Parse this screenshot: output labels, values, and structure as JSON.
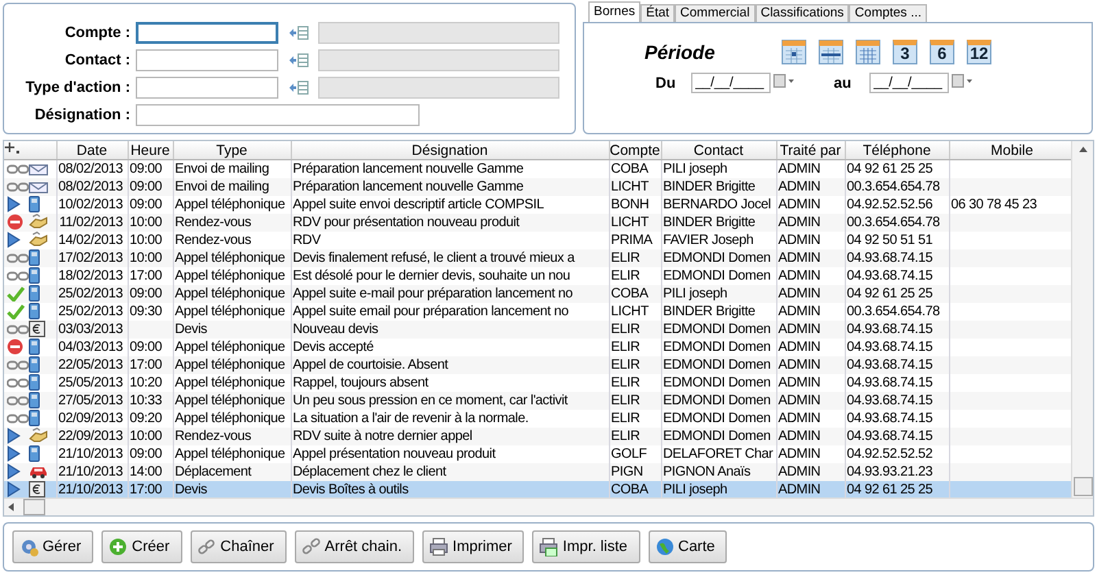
{
  "filter_form": {
    "fields": [
      {
        "label": "Compte :",
        "kind": "lookup",
        "focused": true
      },
      {
        "label": "Contact :",
        "kind": "lookup",
        "focused": false
      },
      {
        "label": "Type d'action :",
        "kind": "lookup",
        "focused": false
      },
      {
        "label": "Désignation :",
        "kind": "text",
        "focused": false
      }
    ]
  },
  "tabs": [
    {
      "label": "Bornes",
      "selected": true
    },
    {
      "label": "État",
      "selected": false
    },
    {
      "label": "Commercial",
      "selected": false
    },
    {
      "label": "Classifications",
      "selected": false
    },
    {
      "label": "Comptes ...",
      "selected": false
    }
  ],
  "period": {
    "title": "Période",
    "buttons": [
      {
        "kind": "day"
      },
      {
        "kind": "week"
      },
      {
        "kind": "month"
      },
      {
        "kind": "count",
        "label": "3"
      },
      {
        "kind": "count",
        "label": "6"
      },
      {
        "kind": "count",
        "label": "12"
      }
    ],
    "from": {
      "label": "Du",
      "value": "__/__/____"
    },
    "to": {
      "label": "au",
      "value": "__/__/____"
    }
  },
  "table": {
    "columns": [
      "Date",
      "Heure",
      "Type",
      "Désignation",
      "Compte",
      "Contact",
      "Traité par",
      "Téléphone",
      "Mobile"
    ],
    "rows": [
      {
        "icons": [
          {
            "kind": "link"
          },
          {
            "kind": "mailing"
          }
        ],
        "selected": false,
        "cells": [
          "08/02/2013",
          "09:00",
          "Envoi de mailing",
          "Préparation lancement nouvelle Gamme",
          "COBA",
          "PILI joseph",
          "ADMIN",
          "04 92 61 25 25",
          ""
        ]
      },
      {
        "icons": [
          {
            "kind": "link"
          },
          {
            "kind": "mailing"
          }
        ],
        "selected": false,
        "cells": [
          "08/02/2013",
          "09:00",
          "Envoi de mailing",
          "Préparation lancement nouvelle Gamme",
          "LICHT",
          "BINDER Brigitte",
          "ADMIN",
          "00.3.654.654.78",
          ""
        ]
      },
      {
        "icons": [
          {
            "kind": "play"
          },
          {
            "kind": "phone"
          }
        ],
        "selected": false,
        "cells": [
          "10/02/2013",
          "09:00",
          "Appel téléphonique",
          "Appel suite envoi descriptif article COMPSIL",
          "BONH",
          "BERNARDO Jocel",
          "ADMIN",
          "04.92.52.52.56",
          "06 30 78 45 23"
        ]
      },
      {
        "icons": [
          {
            "kind": "stop"
          },
          {
            "kind": "meeting"
          }
        ],
        "selected": false,
        "cells": [
          "11/02/2013",
          "10:00",
          "Rendez-vous",
          "RDV pour présentation nouveau produit",
          "LICHT",
          "BINDER Brigitte",
          "ADMIN",
          "00.3.654.654.78",
          ""
        ]
      },
      {
        "icons": [
          {
            "kind": "play"
          },
          {
            "kind": "meeting"
          }
        ],
        "selected": false,
        "cells": [
          "14/02/2013",
          "10:00",
          "Rendez-vous",
          "RDV",
          "PRIMA",
          "FAVIER Joseph",
          "ADMIN",
          "04 92 50 51 51",
          ""
        ]
      },
      {
        "icons": [
          {
            "kind": "link"
          },
          {
            "kind": "phone"
          }
        ],
        "selected": false,
        "cells": [
          "17/02/2013",
          "10:00",
          "Appel téléphonique",
          "Devis finalement refusé, le client a trouvé mieux a",
          "ELIR",
          "EDMONDI Domen",
          "ADMIN",
          "04.93.68.74.15",
          ""
        ]
      },
      {
        "icons": [
          {
            "kind": "link"
          },
          {
            "kind": "phone"
          }
        ],
        "selected": false,
        "cells": [
          "18/02/2013",
          "17:00",
          "Appel téléphonique",
          "Est désolé pour le dernier devis, souhaite un nou",
          "ELIR",
          "EDMONDI Domen",
          "ADMIN",
          "04.93.68.74.15",
          ""
        ]
      },
      {
        "icons": [
          {
            "kind": "check"
          },
          {
            "kind": "phone"
          }
        ],
        "selected": false,
        "cells": [
          "25/02/2013",
          "09:00",
          "Appel téléphonique",
          "Appel suite e-mail pour préparation lancement no",
          "COBA",
          "PILI joseph",
          "ADMIN",
          "04 92 61 25 25",
          ""
        ]
      },
      {
        "icons": [
          {
            "kind": "check"
          },
          {
            "kind": "phone"
          }
        ],
        "selected": false,
        "cells": [
          "25/02/2013",
          "09:30",
          "Appel téléphonique",
          "Appel suite email pour préparation lancement no",
          "LICHT",
          "BINDER Brigitte",
          "ADMIN",
          "00.3.654.654.78",
          ""
        ]
      },
      {
        "icons": [
          {
            "kind": "link"
          },
          {
            "kind": "quote"
          }
        ],
        "selected": false,
        "cells": [
          "03/03/2013",
          "",
          "Devis",
          "Nouveau devis",
          "ELIR",
          "EDMONDI Domen",
          "ADMIN",
          "04.93.68.74.15",
          ""
        ]
      },
      {
        "icons": [
          {
            "kind": "stop"
          },
          {
            "kind": "phone"
          }
        ],
        "selected": false,
        "cells": [
          "04/03/2013",
          "09:00",
          "Appel téléphonique",
          "Devis accepté",
          "ELIR",
          "EDMONDI Domen",
          "ADMIN",
          "04.93.68.74.15",
          ""
        ]
      },
      {
        "icons": [
          {
            "kind": "link"
          },
          {
            "kind": "phone"
          }
        ],
        "selected": false,
        "cells": [
          "22/05/2013",
          "17:00",
          "Appel téléphonique",
          "Appel de courtoisie. Absent",
          "ELIR",
          "EDMONDI Domen",
          "ADMIN",
          "04.93.68.74.15",
          ""
        ]
      },
      {
        "icons": [
          {
            "kind": "link"
          },
          {
            "kind": "phone"
          }
        ],
        "selected": false,
        "cells": [
          "25/05/2013",
          "10:20",
          "Appel téléphonique",
          "Rappel, toujours absent",
          "ELIR",
          "EDMONDI Domen",
          "ADMIN",
          "04.93.68.74.15",
          ""
        ]
      },
      {
        "icons": [
          {
            "kind": "link"
          },
          {
            "kind": "phone"
          }
        ],
        "selected": false,
        "cells": [
          "27/05/2013",
          "10:33",
          "Appel téléphonique",
          "Un peu sous pression en ce moment, car l'activit",
          "ELIR",
          "EDMONDI Domen",
          "ADMIN",
          "04.93.68.74.15",
          ""
        ]
      },
      {
        "icons": [
          {
            "kind": "link"
          },
          {
            "kind": "phone"
          }
        ],
        "selected": false,
        "cells": [
          "02/09/2013",
          "09:20",
          "Appel téléphonique",
          "La situation a l'air de revenir à la normale.",
          "ELIR",
          "EDMONDI Domen",
          "ADMIN",
          "04.93.68.74.15",
          ""
        ]
      },
      {
        "icons": [
          {
            "kind": "play"
          },
          {
            "kind": "meeting"
          }
        ],
        "selected": false,
        "cells": [
          "22/09/2013",
          "10:00",
          "Rendez-vous",
          "RDV suite à notre dernier appel",
          "ELIR",
          "EDMONDI Domen",
          "ADMIN",
          "04.93.68.74.15",
          ""
        ]
      },
      {
        "icons": [
          {
            "kind": "play"
          },
          {
            "kind": "phone"
          }
        ],
        "selected": false,
        "cells": [
          "21/10/2013",
          "09:00",
          "Appel téléphonique",
          "Appel présentation nouveau produit",
          "GOLF",
          "DELAFORET Char",
          "ADMIN",
          "04.92.52.52.52",
          ""
        ]
      },
      {
        "icons": [
          {
            "kind": "play"
          },
          {
            "kind": "car"
          }
        ],
        "selected": false,
        "cells": [
          "21/10/2013",
          "14:00",
          "Déplacement",
          "Déplacement chez le client",
          "PIGN",
          "PIGNON Anaïs",
          "ADMIN",
          "04.93.93.21.23",
          ""
        ]
      },
      {
        "icons": [
          {
            "kind": "play"
          },
          {
            "kind": "quote"
          }
        ],
        "selected": true,
        "cells": [
          "21/10/2013",
          "17:00",
          "Devis",
          "Devis Boîtes à outils",
          "COBA",
          "PILI joseph",
          "ADMIN",
          "04 92 61 25 25",
          ""
        ]
      }
    ]
  },
  "buttons": [
    {
      "label": "Gérer",
      "kind": "manage"
    },
    {
      "label": "Créer",
      "kind": "create"
    },
    {
      "label": "Chaîner",
      "kind": "chain"
    },
    {
      "label": "Arrêt chain.",
      "kind": "unchain"
    },
    {
      "label": "Imprimer",
      "kind": "print"
    },
    {
      "label": "Impr. liste",
      "kind": "printlist"
    },
    {
      "label": "Carte",
      "kind": "map"
    }
  ]
}
